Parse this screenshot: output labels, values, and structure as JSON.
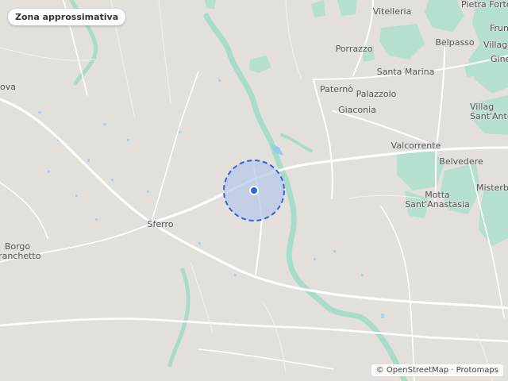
{
  "map": {
    "badge_label": "Zona approssimativa",
    "attribution": "© OpenStreetMap · Protomaps",
    "colors": {
      "land": "#e3e0dc",
      "roads": "#ffffff",
      "river": "#a7dcc9",
      "vegetation": "#b4e0cd",
      "water_spots": "#9fd7ef",
      "area_fill": "#b5c8e8",
      "area_stroke": "#2f63d8",
      "marker": "#2f63d8"
    },
    "labels": {
      "vitelleria": "Vitelleria",
      "pietra_forte": "Pietra Forte",
      "porrazzo": "Porrazzo",
      "belpasso": "Belpasso",
      "frun": "Frun",
      "villag_top": "Villag",
      "ginestre": "Gine",
      "santa_marina": "Santa Marina",
      "paterno": "Paternò",
      "palazzolo": "Palazzolo",
      "giaconia": "Giaconia",
      "villaggio_santantonio": "Villag\nSant'Anto",
      "valcorrente": "Valcorrente",
      "belvedere": "Belvedere",
      "misterbianco": "Misterbi",
      "motta_santanastasia": "Motta\nSant'Anastasia",
      "sferro": "Sferro",
      "borgo_franchetto": "Borgo\nFranchetto",
      "ova": "ova"
    }
  }
}
